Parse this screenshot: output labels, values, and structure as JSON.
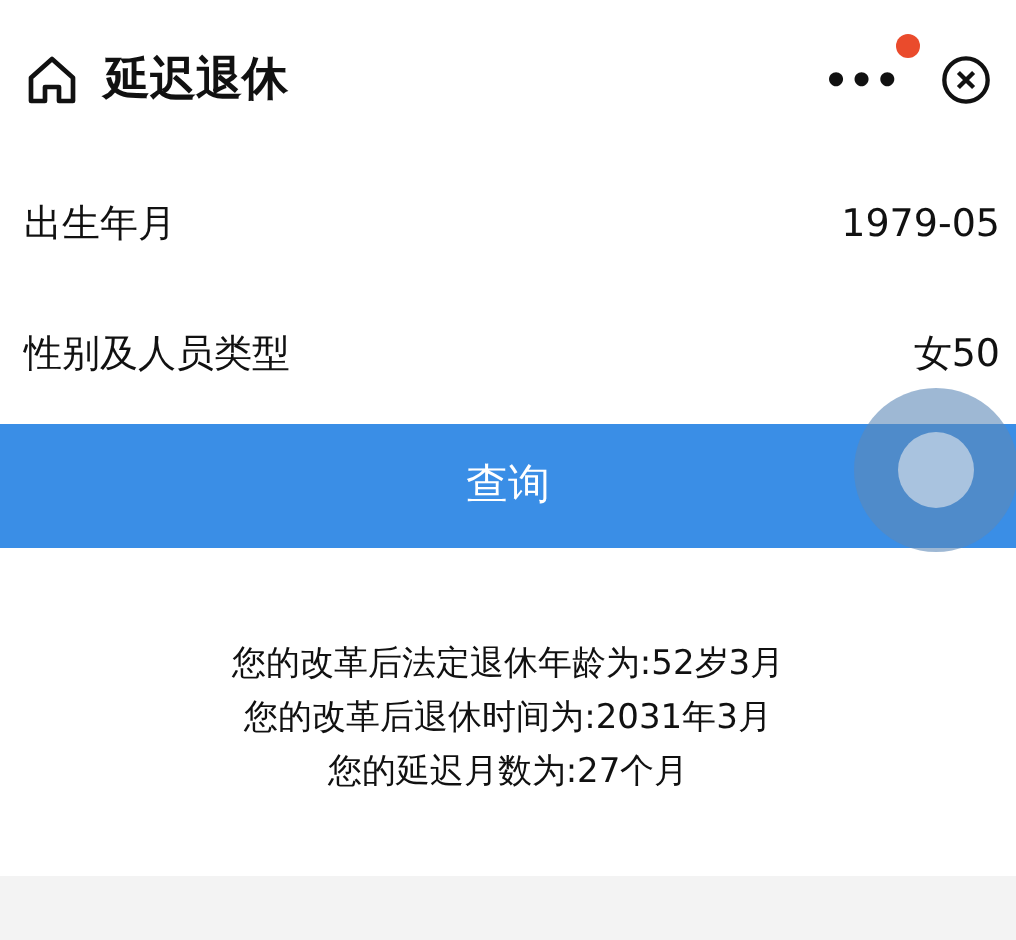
{
  "header": {
    "title": "延迟退休",
    "more": "•••",
    "has_notification": true
  },
  "fields": [
    {
      "label": "出生年月",
      "value": "1979-05"
    },
    {
      "label": "性别及人员类型",
      "value": "女50"
    }
  ],
  "query_button": {
    "label": "查询"
  },
  "results": [
    "您的改革后法定退休年龄为:52岁3月",
    "您的改革后退休时间为:2031年3月",
    "您的延迟月数为:27个月"
  ]
}
